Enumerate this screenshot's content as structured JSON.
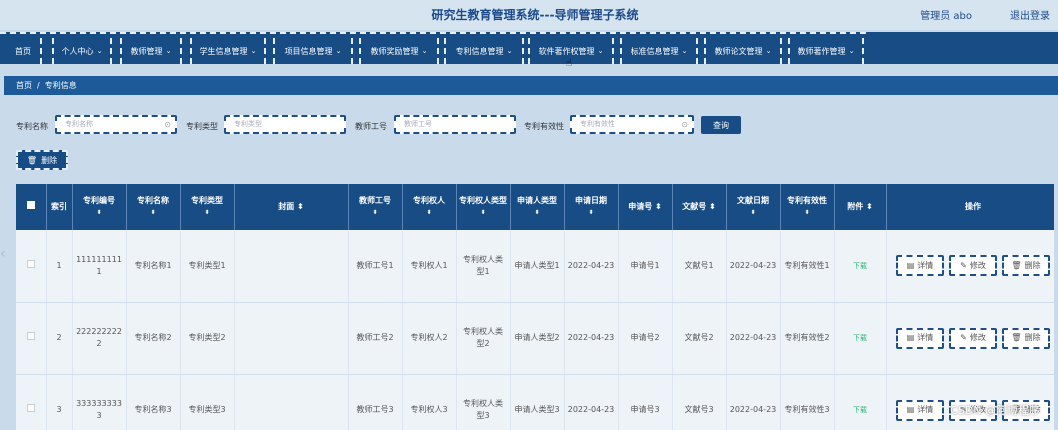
{
  "header": {
    "title": "研究生教育管理系统---导师管理子系统",
    "user": "管理员 abo",
    "logout": "退出登录"
  },
  "nav": [
    {
      "label": "首页",
      "has_dropdown": false
    },
    {
      "label": "个人中心",
      "has_dropdown": true
    },
    {
      "label": "教师管理",
      "has_dropdown": true
    },
    {
      "label": "学生信息管理",
      "has_dropdown": true
    },
    {
      "label": "项目信息管理",
      "has_dropdown": true
    },
    {
      "label": "教师奖励管理",
      "has_dropdown": true
    },
    {
      "label": "专利信息管理",
      "has_dropdown": true
    },
    {
      "label": "软件著作权管理",
      "has_dropdown": true
    },
    {
      "label": "标准信息管理",
      "has_dropdown": true
    },
    {
      "label": "教师论文管理",
      "has_dropdown": true
    },
    {
      "label": "教师著作管理",
      "has_dropdown": true
    }
  ],
  "breadcrumb": {
    "home": "首页",
    "separator": "/",
    "current": "专利信息"
  },
  "filters": [
    {
      "label": "专利名称",
      "placeholder": "专利名称"
    },
    {
      "label": "专利类型",
      "placeholder": "专利类型"
    },
    {
      "label": "教师工号",
      "placeholder": "教师工号"
    },
    {
      "label": "专利有效性",
      "placeholder": "专利有效性"
    }
  ],
  "buttons": {
    "query": "查询",
    "delete": "删除"
  },
  "table": {
    "headers": [
      "索引",
      "专利编号",
      "专利名称",
      "专利类型",
      "封面",
      "教师工号",
      "专利权人",
      "专利权人类型",
      "申请人类型",
      "申请日期",
      "申请号",
      "文献号",
      "文献日期",
      "专利有效性",
      "附件",
      "操作"
    ],
    "rows": [
      {
        "index": "1",
        "patent_no": "1111111111",
        "name": "专利名称1",
        "type": "专利类型1",
        "cover": "",
        "teacher_no": "教师工号1",
        "holder": "专利权人1",
        "holder_type": "专利权人类型1",
        "applicant_type": "申请人类型1",
        "apply_date": "2022-04-23",
        "apply_no": "申请号1",
        "doc_no": "文献号1",
        "doc_date": "2022-04-23",
        "validity": "专利有效性1",
        "attachment": "下载"
      },
      {
        "index": "2",
        "patent_no": "2222222222",
        "name": "专利名称2",
        "type": "专利类型2",
        "cover": "",
        "teacher_no": "教师工号2",
        "holder": "专利权人2",
        "holder_type": "专利权人类型2",
        "applicant_type": "申请人类型2",
        "apply_date": "2022-04-23",
        "apply_no": "申请号2",
        "doc_no": "文献号2",
        "doc_date": "2022-04-23",
        "validity": "专利有效性2",
        "attachment": "下载"
      },
      {
        "index": "3",
        "patent_no": "3333333333",
        "name": "专利名称3",
        "type": "专利类型3",
        "cover": "",
        "teacher_no": "教师工号3",
        "holder": "专利权人3",
        "holder_type": "专利权人类型3",
        "applicant_type": "申请人类型3",
        "apply_date": "2022-04-23",
        "apply_no": "申请号3",
        "doc_no": "文献号3",
        "doc_date": "2022-04-23",
        "validity": "专利有效性3",
        "attachment": "下载"
      }
    ],
    "row_actions": {
      "detail": "详情",
      "edit": "修改",
      "delete": "删除"
    }
  },
  "watermark": "CSDN @阿博程序"
}
